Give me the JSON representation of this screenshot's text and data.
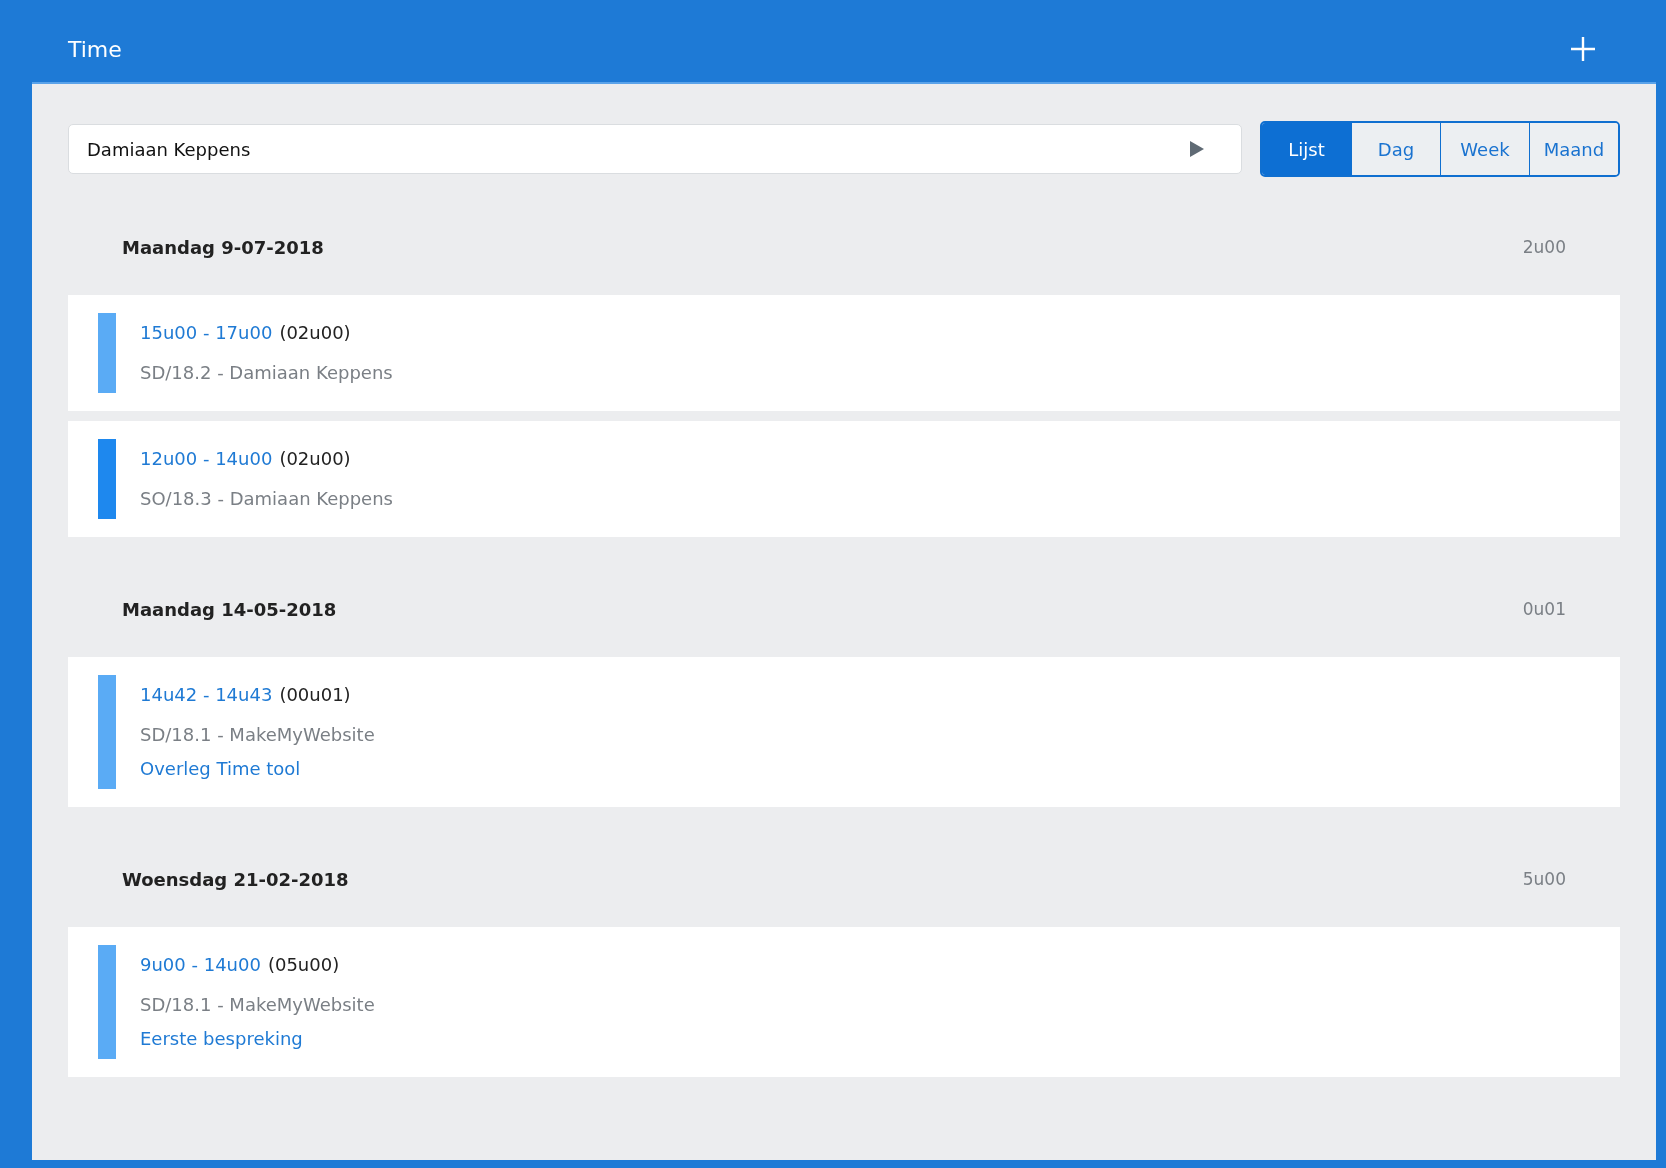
{
  "header": {
    "title": "Time"
  },
  "search": {
    "value": "Damiaan Keppens"
  },
  "views": [
    {
      "label": "Lijst",
      "selected": true
    },
    {
      "label": "Dag",
      "selected": false
    },
    {
      "label": "Week",
      "selected": false
    },
    {
      "label": "Maand",
      "selected": false
    }
  ],
  "days": [
    {
      "title": "Maandag 9-07-2018",
      "total": "2u00",
      "entries": [
        {
          "range": "15u00 - 17u00",
          "duration": "(02u00)",
          "project": "SD/18.2 - Damiaan Keppens",
          "color": "#5aabf5"
        },
        {
          "range": "12u00 - 14u00",
          "duration": "(02u00)",
          "project": "SO/18.3 - Damiaan Keppens",
          "color": "#1e88ee"
        }
      ]
    },
    {
      "title": "Maandag 14-05-2018",
      "total": "0u01",
      "entries": [
        {
          "range": "14u42 - 14u43",
          "duration": "(00u01)",
          "project": "SD/18.1 - MakeMyWebsite",
          "note": "Overleg Time tool",
          "color": "#5aabf5"
        }
      ]
    },
    {
      "title": "Woensdag 21-02-2018",
      "total": "5u00",
      "entries": [
        {
          "range": "9u00 - 14u00",
          "duration": "(05u00)",
          "project": "SD/18.1 - MakeMyWebsite",
          "note": "Eerste bespreking",
          "color": "#5aabf5"
        }
      ]
    }
  ]
}
